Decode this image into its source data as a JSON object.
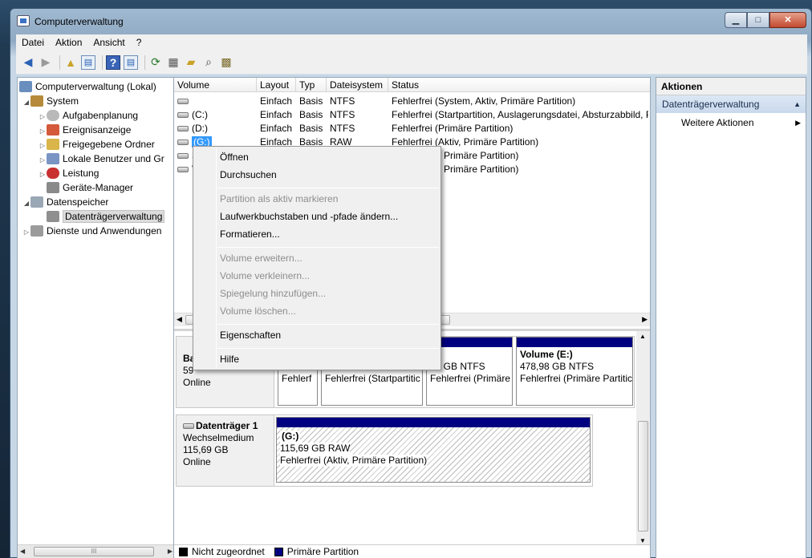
{
  "window": {
    "title": "Computerverwaltung",
    "buttons": {
      "min": "▁",
      "max": "□",
      "close": "✕"
    }
  },
  "menubar": [
    "Datei",
    "Aktion",
    "Ansicht",
    "?"
  ],
  "tree": {
    "items": [
      {
        "label": "Computerverwaltung (Lokal)",
        "icon": "computer-icon"
      },
      {
        "label": "System",
        "icon": "tools-icon"
      },
      {
        "label": "Aufgabenplanung",
        "icon": "clock-icon"
      },
      {
        "label": "Ereignisanzeige",
        "icon": "event-log-icon"
      },
      {
        "label": "Freigegebene Ordner",
        "icon": "shared-folder-icon"
      },
      {
        "label": "Lokale Benutzer und Gr",
        "icon": "users-icon"
      },
      {
        "label": "Leistung",
        "icon": "performance-icon"
      },
      {
        "label": "Geräte-Manager",
        "icon": "device-manager-icon"
      },
      {
        "label": "Datenspeicher",
        "icon": "storage-icon"
      },
      {
        "label": "Datenträgerverwaltung",
        "icon": "disk-management-icon"
      },
      {
        "label": "Dienste und Anwendungen",
        "icon": "services-icon"
      }
    ],
    "scroll_grip": "III"
  },
  "volumes": {
    "columns": [
      "Volume",
      "Layout",
      "Typ",
      "Dateisystem",
      "Status"
    ],
    "rows": [
      {
        "volume": "",
        "layout": "Einfach",
        "typ": "Basis",
        "fs": "NTFS",
        "status": "Fehlerfrei (System, Aktiv, Primäre Partition)"
      },
      {
        "volume": "(C:)",
        "layout": "Einfach",
        "typ": "Basis",
        "fs": "NTFS",
        "status": "Fehlerfrei (Startpartition, Auslagerungsdatei, Absturzabbild, P"
      },
      {
        "volume": "(D:)",
        "layout": "Einfach",
        "typ": "Basis",
        "fs": "NTFS",
        "status": "Fehlerfrei (Primäre Partition)"
      },
      {
        "volume": "(G:)",
        "layout": "Einfach",
        "typ": "Basis",
        "fs": "RAW",
        "status": "Fehlerfrei (Aktiv, Primäre Partition)"
      },
      {
        "volume": "S",
        "layout": "",
        "typ": "",
        "fs": "",
        "status": "Primäre Partition)"
      },
      {
        "volume": "V",
        "layout": "",
        "typ": "",
        "fs": "",
        "status": "Primäre Partition)"
      }
    ]
  },
  "disks": {
    "disk0": {
      "name": "Ba",
      "size": "59",
      "status": "Online",
      "parts": [
        {
          "l1": "",
          "l2": "",
          "l3": "Fehlerf"
        },
        {
          "l1": "",
          "l2": "",
          "l3": "Fehlerfrei (Startpartitic"
        },
        {
          "l1": ":)",
          "l2": "53 GB NTFS",
          "l3": "Fehlerfrei (Primäre"
        },
        {
          "l1": "Volume  (E:)",
          "l2": "478,98 GB NTFS",
          "l3": "Fehlerfrei (Primäre Partitic"
        }
      ]
    },
    "disk1": {
      "name": "Datenträger 1",
      "type": "Wechselmedium",
      "size": "115,69 GB",
      "status": "Online",
      "part": {
        "l1": "(G:)",
        "l2": "115,69 GB RAW",
        "l3": "Fehlerfrei (Aktiv, Primäre Partition)"
      }
    }
  },
  "legend": [
    {
      "label": "Nicht zugeordnet",
      "color": "#000000"
    },
    {
      "label": "Primäre Partition",
      "color": "#000080"
    }
  ],
  "actions": {
    "header": "Aktionen",
    "section": "Datenträgerverwaltung",
    "item": "Weitere Aktionen"
  },
  "context_menu": {
    "items": [
      {
        "label": "Öffnen",
        "enabled": true
      },
      {
        "label": "Durchsuchen",
        "enabled": true
      },
      {
        "label": "Partition als aktiv markieren",
        "enabled": false
      },
      {
        "label": "Laufwerkbuchstaben und -pfade ändern...",
        "enabled": true
      },
      {
        "label": "Formatieren...",
        "enabled": true
      },
      {
        "label": "Volume erweitern...",
        "enabled": false
      },
      {
        "label": "Volume verkleinern...",
        "enabled": false
      },
      {
        "label": "Spiegelung hinzufügen...",
        "enabled": false
      },
      {
        "label": "Volume löschen...",
        "enabled": false
      },
      {
        "label": "Eigenschaften",
        "enabled": true
      },
      {
        "label": "Hilfe",
        "enabled": true
      }
    ]
  }
}
